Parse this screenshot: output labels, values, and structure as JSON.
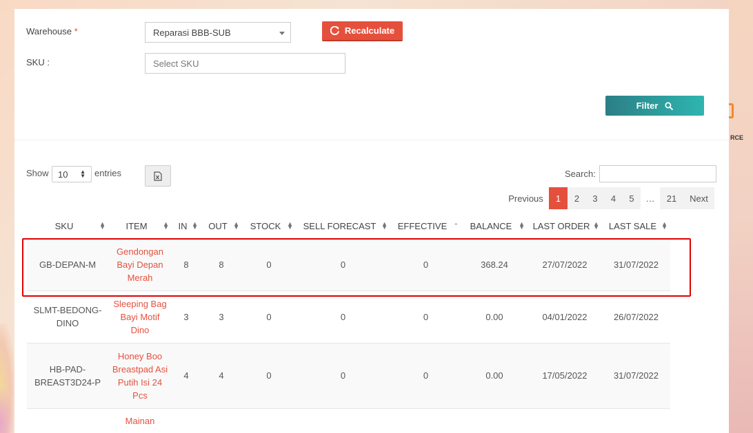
{
  "filters": {
    "warehouse_label": "Warehouse",
    "required_mark": "*",
    "warehouse_value": "Reparasi BBB-SUB",
    "sku_label": "SKU :",
    "sku_placeholder": "Select SKU",
    "recalculate_label": "Recalculate",
    "filter_label": "Filter"
  },
  "table_controls": {
    "show_label": "Show",
    "entries_value": "10",
    "entries_label": "entries",
    "search_label": "Search:"
  },
  "pagination": {
    "previous": "Previous",
    "pages": [
      "1",
      "2",
      "3",
      "4",
      "5"
    ],
    "ellipsis": "…",
    "last": "21",
    "next": "Next",
    "current": "1"
  },
  "table": {
    "columns": [
      "SKU",
      "ITEM",
      "IN",
      "OUT",
      "STOCK",
      "SELL FORECAST",
      "EFFECTIVE",
      "BALANCE",
      "LAST ORDER",
      "LAST SALE"
    ],
    "rows": [
      {
        "sku": "GB-DEPAN-M",
        "item": "Gendongan Bayi Depan Merah",
        "in": "8",
        "out": "8",
        "stock": "0",
        "sell_forecast": "0",
        "effective": "0",
        "balance": "368.24",
        "last_order": "27/07/2022",
        "last_sale": "31/07/2022"
      },
      {
        "sku": "SLMT-BEDONG-DINO",
        "item": "Sleeping Bag Bayi Motif Dino",
        "in": "3",
        "out": "3",
        "stock": "0",
        "sell_forecast": "0",
        "effective": "0",
        "balance": "0.00",
        "last_order": "04/01/2022",
        "last_sale": "26/07/2022"
      },
      {
        "sku": "HB-PAD-BREAST3D24-P",
        "item": "Honey Boo Breastpad Asi Putih Isi 24 Pcs",
        "in": "4",
        "out": "4",
        "stock": "0",
        "sell_forecast": "0",
        "effective": "0",
        "balance": "0.00",
        "last_order": "17/05/2022",
        "last_sale": "31/07/2022"
      },
      {
        "sku": "",
        "item": "Mainan",
        "in": "",
        "out": "",
        "stock": "",
        "sell_forecast": "",
        "effective": "",
        "balance": "",
        "last_order": "",
        "last_sale": ""
      }
    ]
  },
  "background": {
    "partial_text": "RCE"
  },
  "colors": {
    "accent_red": "#e5503d",
    "filter_teal": "#2b7f86",
    "highlight_border": "#e00000"
  }
}
